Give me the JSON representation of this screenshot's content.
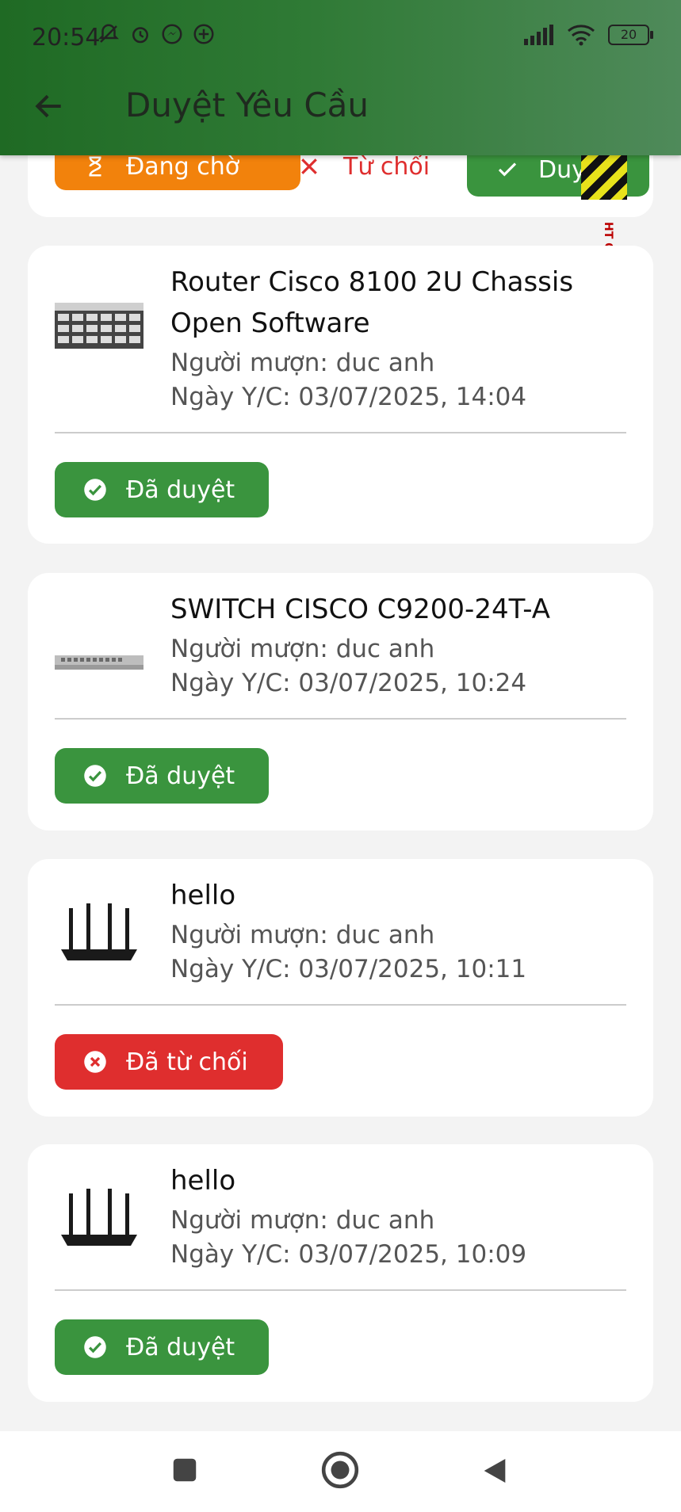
{
  "status_bar": {
    "time": "20:54",
    "battery": "20"
  },
  "app_bar": {
    "title": "Duyệt Yêu Cầu"
  },
  "filter_bar": {
    "pending": "Đang chờ",
    "rejected": "Từ chối",
    "approved": "Duyệt",
    "overflow_text": "HT OVERFLOWE"
  },
  "requests": [
    {
      "name": "Router Cisco 8100 2U Chassis Open Software",
      "borrower": "Người mượn: duc anh",
      "date": "Ngày Y/C: 03/07/2025, 14:04",
      "status": "Đã duyệt"
    },
    {
      "name": "SWITCH CISCO C9200-24T-A",
      "borrower": "Người mượn: duc anh",
      "date": "Ngày Y/C: 03/07/2025, 10:24",
      "status": "Đã duyệt"
    },
    {
      "name": "hello",
      "borrower": "Người mượn: duc anh",
      "date": "Ngày Y/C: 03/07/2025, 10:11",
      "status": "Đã từ chối"
    },
    {
      "name": "hello",
      "borrower": "Người mượn: duc anh",
      "date": "Ngày Y/C: 03/07/2025, 10:09",
      "status": "Đã duyệt"
    }
  ],
  "colors": {
    "approved": "#3a943e",
    "rejected": "#df2e2e",
    "pending": "#f2820c",
    "appbar": "#2f7a35"
  },
  "nav": [
    "recent-apps-icon",
    "home-icon",
    "back-nav-icon"
  ]
}
